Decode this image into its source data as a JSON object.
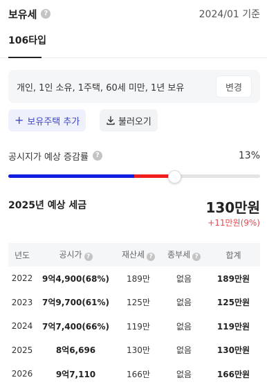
{
  "header": {
    "title": "보유세",
    "help_icon": "question-icon",
    "date_basis": "2024/01 기준"
  },
  "tabs": [
    {
      "label": "106타입",
      "active": true
    }
  ],
  "conditions": {
    "summary": "개인, 1인 소유, 1주택, 60세 미만, 1년 보유",
    "change_label": "변경"
  },
  "actions": {
    "add_label": "보유주택 추가",
    "load_label": "불러오기"
  },
  "rate": {
    "label": "공시지가 예상 증감률",
    "value": "13%",
    "fraction": 0.13
  },
  "estimate": {
    "label": "2025년 예상 세금",
    "amount": "130만원",
    "change": "+11만원(9%)"
  },
  "table": {
    "headers": {
      "year": "년도",
      "price": "공시가",
      "property_tax": "재산세",
      "comprehensive_tax": "종부세",
      "total": "합계"
    },
    "rows": [
      {
        "year": "2022",
        "price": "9억4,900(68%)",
        "property_tax": "189만",
        "comprehensive_tax": "없음",
        "total": "189만원"
      },
      {
        "year": "2023",
        "price": "7억9,700(61%)",
        "property_tax": "125만",
        "comprehensive_tax": "없음",
        "total": "125만원"
      },
      {
        "year": "2024",
        "price": "7억7,400(66%)",
        "property_tax": "119만",
        "comprehensive_tax": "없음",
        "total": "119만원"
      },
      {
        "year": "2025",
        "price": "8억6,696",
        "property_tax": "130만",
        "comprehensive_tax": "없음",
        "total": "130만원"
      },
      {
        "year": "2026",
        "price": "9억7,110",
        "property_tax": "166만",
        "comprehensive_tax": "없음",
        "total": "166만원"
      }
    ]
  },
  "colors": {
    "accent": "#3f47c6",
    "slider_blue": "#0f1ee0",
    "slider_red": "#ef1f1f",
    "increase": "#e5484d"
  }
}
